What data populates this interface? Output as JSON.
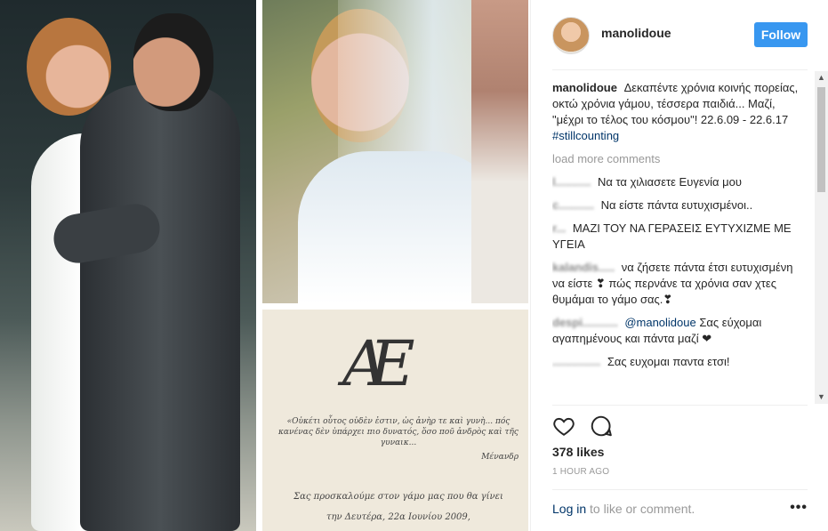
{
  "post": {
    "username": "manolidoue",
    "follow_label": "Follow",
    "caption_user": "manolidoue",
    "caption_text": "Δεκαπέντε χρόνια κοινής πορείας, οκτώ χρόνια γάμου, τέσσερα παιδιά... Μαζί, \"μέχρι το τέλος του κόσμου\"! 22.6.09 - 22.6.17",
    "caption_hashtag": "#stillcounting",
    "load_more": "load more comments",
    "likes": "378 likes",
    "time": "1 HOUR AGO",
    "login_link": "Log in",
    "login_rest": " to like or comment.",
    "more_label": "•••"
  },
  "comments": [
    {
      "user": "l...........",
      "text": "Να τα χιλιασετε Ευγενία μου"
    },
    {
      "user": "c...........",
      "text": "Να είστε πάντα ευτυχισμένοι.."
    },
    {
      "user": "r...",
      "text": "ΜΑΖΙ ΤΟΥ ΝΑ ΓΕΡΑΣΕΙΣ ΕΥΤΥΧΙΖΜΕ ΜΕ ΥΓΕΙΑ"
    },
    {
      "user": "kalandis.....",
      "text": "να ζήσετε πάντα έτσι ευτυχισμένη να είστε ❣ πώς περνάνε τα χρόνια σαν χτες θυμάμαι το γάμο σας.❣"
    },
    {
      "user": "despi...........",
      "mention": "@manolidoue",
      "text": "Σας εύχομαι αγαπημένους και πάντα μαζί ❤"
    },
    {
      "user": "...............",
      "text": "Σας ευχομαι παντα ετσι!"
    }
  ],
  "invitation": {
    "monogram": "ΑΕ",
    "quote": "«Οὐκέτι οὗτος οὐδὲν ἐστιν, ὡς ἀνὴρ τε καὶ γυνὴ... πός κανένας δὲν ὑπάρχει πιο δυνατός, ὅσο ποῦ ἀνδρὸς καὶ τῆς γυναικ...",
    "quote_author": "Μένανδρ",
    "invite_line1": "Σας προσκαλούμε στον γάμο μας που θα γίνει",
    "invite_line2": "την Δευτέρα, 22α Ιουνίου 2009,"
  },
  "colors": {
    "accent": "#3897f0",
    "link": "#003569",
    "muted": "#999999"
  },
  "icons": {
    "like": "heart-icon",
    "comment": "comment-icon",
    "options": "more-icon"
  }
}
